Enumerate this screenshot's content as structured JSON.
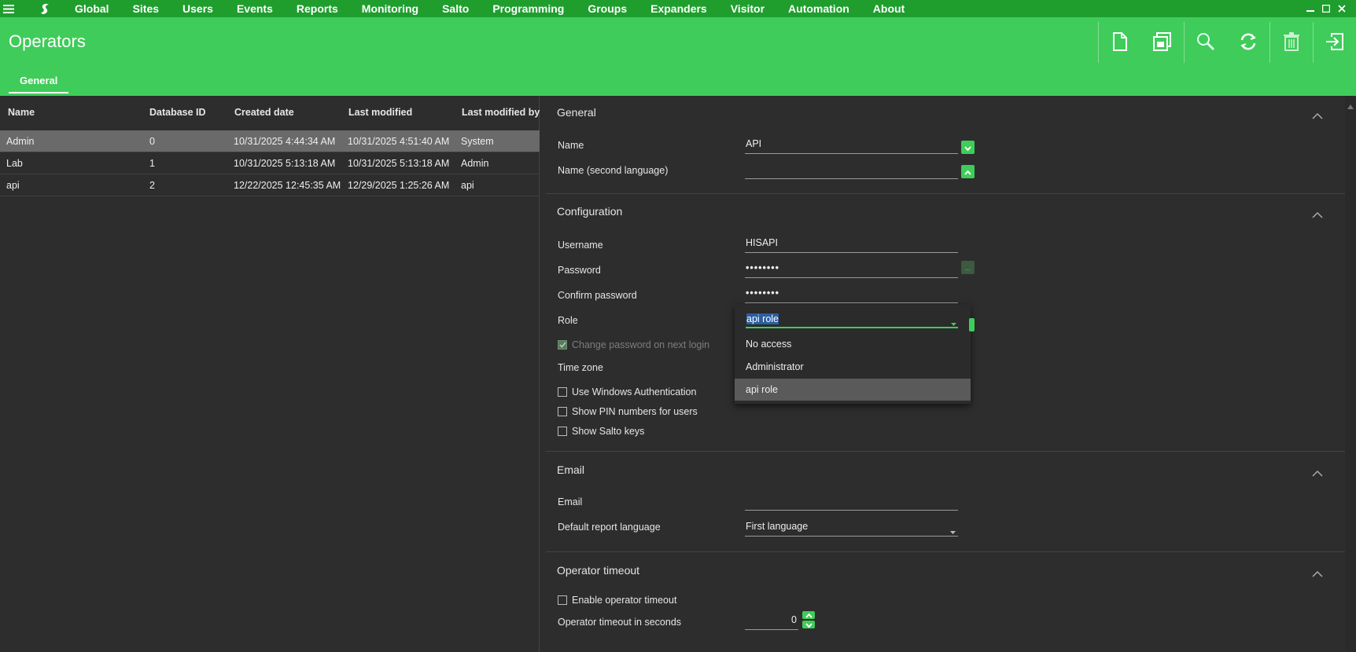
{
  "menu": {
    "items": [
      "Global",
      "Sites",
      "Users",
      "Events",
      "Reports",
      "Monitoring",
      "Salto",
      "Programming",
      "Groups",
      "Expanders",
      "Visitor",
      "Automation",
      "About"
    ]
  },
  "header": {
    "title": "Operators",
    "tab": "General",
    "toolbar_icons": [
      "new-document-icon",
      "save-icon",
      "search-icon",
      "refresh-icon",
      "delete-icon",
      "exit-icon"
    ]
  },
  "table": {
    "columns": [
      "Name",
      "Database ID",
      "Created date",
      "Last modified",
      "Last modified by"
    ],
    "rows": [
      [
        "Admin",
        "0",
        "10/31/2025 4:44:34 AM",
        "10/31/2025 4:51:40 AM",
        "System"
      ],
      [
        "Lab",
        "1",
        "10/31/2025 5:13:18 AM",
        "10/31/2025 5:13:18 AM",
        "Admin"
      ],
      [
        "api",
        "2",
        "12/22/2025 12:45:35 AM",
        "12/29/2025 1:25:26 AM",
        "api"
      ]
    ],
    "selected_row": 0
  },
  "general": {
    "title": "General",
    "name_label": "Name",
    "name_value": "API",
    "name2_label": "Name (second language)",
    "name2_value": ""
  },
  "configuration": {
    "title": "Configuration",
    "username_label": "Username",
    "username_value": "HISAPI",
    "password_label": "Password",
    "password_value": "••••••••",
    "confirm_label": "Confirm password",
    "confirm_value": "••••••••",
    "role_label": "Role",
    "change_pw_label": "Change password on next login",
    "timezone_label": "Time zone",
    "windows_auth_label": "Use Windows Authentication",
    "show_pin_label": "Show PIN numbers for users",
    "show_salto_label": "Show Salto keys",
    "password_btn": "..."
  },
  "role_dropdown": {
    "value": "api role",
    "options": [
      "No access",
      "Administrator",
      "api role"
    ],
    "active_index": 2
  },
  "email": {
    "title": "Email",
    "email_label": "Email",
    "email_value": "",
    "report_lang_label": "Default report language",
    "report_lang_value": "First language"
  },
  "timeout": {
    "title": "Operator timeout",
    "enable_label": "Enable operator timeout",
    "seconds_label": "Operator timeout in seconds",
    "seconds_value": "0"
  },
  "colors": {
    "menubar": "#1f9e2e",
    "header": "#3fcc5a",
    "accent": "#3fcc5a",
    "panel": "#2d2d2d",
    "selected_row": "#6a6a6a"
  }
}
